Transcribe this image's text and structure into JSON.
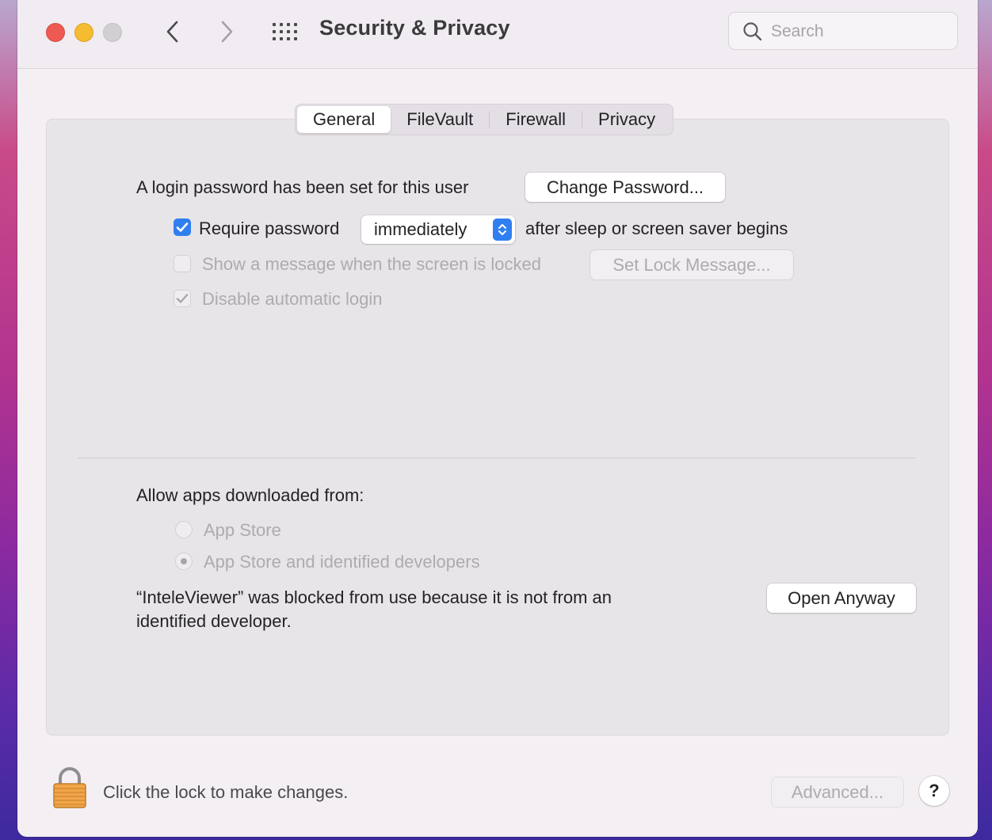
{
  "window": {
    "title": "Security & Privacy",
    "search_placeholder": "Search"
  },
  "toolbar": {
    "back_icon": "chevron-left-icon",
    "forward_icon": "chevron-right-icon",
    "grid_icon": "show-all-grid-icon"
  },
  "tabs": [
    {
      "label": "General",
      "active": true
    },
    {
      "label": "FileVault",
      "active": false
    },
    {
      "label": "Firewall",
      "active": false
    },
    {
      "label": "Privacy",
      "active": false
    }
  ],
  "general": {
    "login_password_text": "A login password has been set for this user",
    "change_password_label": "Change Password...",
    "require_password_label": "Require password",
    "require_password_checked": true,
    "require_password_delay": "immediately",
    "after_sleep_text": "after sleep or screen saver begins",
    "show_message_label": "Show a message when the screen is locked",
    "show_message_checked": false,
    "set_lock_message_label": "Set Lock Message...",
    "disable_auto_login_label": "Disable automatic login",
    "disable_auto_login_checked": true
  },
  "apps": {
    "heading": "Allow apps downloaded from:",
    "options": [
      {
        "label": "App Store",
        "selected": false
      },
      {
        "label": "App Store and identified developers",
        "selected": true
      }
    ],
    "blocked_line1": "“InteleViewer” was blocked from use because it is not from an",
    "blocked_line2": "identified developer.",
    "open_anyway_label": "Open Anyway"
  },
  "footer": {
    "lock_text": "Click the lock to make changes.",
    "advanced_label": "Advanced...",
    "help_label": "?"
  },
  "colors": {
    "accent": "#2f7ff0",
    "close": "#ee5a52",
    "minimize": "#f5bc2f",
    "zoom_disabled": "#d2cfd3"
  }
}
